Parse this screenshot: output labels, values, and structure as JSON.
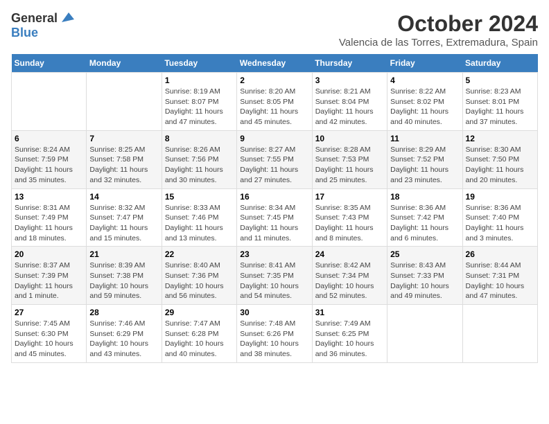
{
  "logo": {
    "general": "General",
    "blue": "Blue"
  },
  "title": {
    "month": "October 2024",
    "location": "Valencia de las Torres, Extremadura, Spain"
  },
  "headers": [
    "Sunday",
    "Monday",
    "Tuesday",
    "Wednesday",
    "Thursday",
    "Friday",
    "Saturday"
  ],
  "weeks": [
    [
      {
        "day": null
      },
      {
        "day": null
      },
      {
        "day": "1",
        "sunrise": "Sunrise: 8:19 AM",
        "sunset": "Sunset: 8:07 PM",
        "daylight": "Daylight: 11 hours and 47 minutes."
      },
      {
        "day": "2",
        "sunrise": "Sunrise: 8:20 AM",
        "sunset": "Sunset: 8:05 PM",
        "daylight": "Daylight: 11 hours and 45 minutes."
      },
      {
        "day": "3",
        "sunrise": "Sunrise: 8:21 AM",
        "sunset": "Sunset: 8:04 PM",
        "daylight": "Daylight: 11 hours and 42 minutes."
      },
      {
        "day": "4",
        "sunrise": "Sunrise: 8:22 AM",
        "sunset": "Sunset: 8:02 PM",
        "daylight": "Daylight: 11 hours and 40 minutes."
      },
      {
        "day": "5",
        "sunrise": "Sunrise: 8:23 AM",
        "sunset": "Sunset: 8:01 PM",
        "daylight": "Daylight: 11 hours and 37 minutes."
      }
    ],
    [
      {
        "day": "6",
        "sunrise": "Sunrise: 8:24 AM",
        "sunset": "Sunset: 7:59 PM",
        "daylight": "Daylight: 11 hours and 35 minutes."
      },
      {
        "day": "7",
        "sunrise": "Sunrise: 8:25 AM",
        "sunset": "Sunset: 7:58 PM",
        "daylight": "Daylight: 11 hours and 32 minutes."
      },
      {
        "day": "8",
        "sunrise": "Sunrise: 8:26 AM",
        "sunset": "Sunset: 7:56 PM",
        "daylight": "Daylight: 11 hours and 30 minutes."
      },
      {
        "day": "9",
        "sunrise": "Sunrise: 8:27 AM",
        "sunset": "Sunset: 7:55 PM",
        "daylight": "Daylight: 11 hours and 27 minutes."
      },
      {
        "day": "10",
        "sunrise": "Sunrise: 8:28 AM",
        "sunset": "Sunset: 7:53 PM",
        "daylight": "Daylight: 11 hours and 25 minutes."
      },
      {
        "day": "11",
        "sunrise": "Sunrise: 8:29 AM",
        "sunset": "Sunset: 7:52 PM",
        "daylight": "Daylight: 11 hours and 23 minutes."
      },
      {
        "day": "12",
        "sunrise": "Sunrise: 8:30 AM",
        "sunset": "Sunset: 7:50 PM",
        "daylight": "Daylight: 11 hours and 20 minutes."
      }
    ],
    [
      {
        "day": "13",
        "sunrise": "Sunrise: 8:31 AM",
        "sunset": "Sunset: 7:49 PM",
        "daylight": "Daylight: 11 hours and 18 minutes."
      },
      {
        "day": "14",
        "sunrise": "Sunrise: 8:32 AM",
        "sunset": "Sunset: 7:47 PM",
        "daylight": "Daylight: 11 hours and 15 minutes."
      },
      {
        "day": "15",
        "sunrise": "Sunrise: 8:33 AM",
        "sunset": "Sunset: 7:46 PM",
        "daylight": "Daylight: 11 hours and 13 minutes."
      },
      {
        "day": "16",
        "sunrise": "Sunrise: 8:34 AM",
        "sunset": "Sunset: 7:45 PM",
        "daylight": "Daylight: 11 hours and 11 minutes."
      },
      {
        "day": "17",
        "sunrise": "Sunrise: 8:35 AM",
        "sunset": "Sunset: 7:43 PM",
        "daylight": "Daylight: 11 hours and 8 minutes."
      },
      {
        "day": "18",
        "sunrise": "Sunrise: 8:36 AM",
        "sunset": "Sunset: 7:42 PM",
        "daylight": "Daylight: 11 hours and 6 minutes."
      },
      {
        "day": "19",
        "sunrise": "Sunrise: 8:36 AM",
        "sunset": "Sunset: 7:40 PM",
        "daylight": "Daylight: 11 hours and 3 minutes."
      }
    ],
    [
      {
        "day": "20",
        "sunrise": "Sunrise: 8:37 AM",
        "sunset": "Sunset: 7:39 PM",
        "daylight": "Daylight: 11 hours and 1 minute."
      },
      {
        "day": "21",
        "sunrise": "Sunrise: 8:39 AM",
        "sunset": "Sunset: 7:38 PM",
        "daylight": "Daylight: 10 hours and 59 minutes."
      },
      {
        "day": "22",
        "sunrise": "Sunrise: 8:40 AM",
        "sunset": "Sunset: 7:36 PM",
        "daylight": "Daylight: 10 hours and 56 minutes."
      },
      {
        "day": "23",
        "sunrise": "Sunrise: 8:41 AM",
        "sunset": "Sunset: 7:35 PM",
        "daylight": "Daylight: 10 hours and 54 minutes."
      },
      {
        "day": "24",
        "sunrise": "Sunrise: 8:42 AM",
        "sunset": "Sunset: 7:34 PM",
        "daylight": "Daylight: 10 hours and 52 minutes."
      },
      {
        "day": "25",
        "sunrise": "Sunrise: 8:43 AM",
        "sunset": "Sunset: 7:33 PM",
        "daylight": "Daylight: 10 hours and 49 minutes."
      },
      {
        "day": "26",
        "sunrise": "Sunrise: 8:44 AM",
        "sunset": "Sunset: 7:31 PM",
        "daylight": "Daylight: 10 hours and 47 minutes."
      }
    ],
    [
      {
        "day": "27",
        "sunrise": "Sunrise: 7:45 AM",
        "sunset": "Sunset: 6:30 PM",
        "daylight": "Daylight: 10 hours and 45 minutes."
      },
      {
        "day": "28",
        "sunrise": "Sunrise: 7:46 AM",
        "sunset": "Sunset: 6:29 PM",
        "daylight": "Daylight: 10 hours and 43 minutes."
      },
      {
        "day": "29",
        "sunrise": "Sunrise: 7:47 AM",
        "sunset": "Sunset: 6:28 PM",
        "daylight": "Daylight: 10 hours and 40 minutes."
      },
      {
        "day": "30",
        "sunrise": "Sunrise: 7:48 AM",
        "sunset": "Sunset: 6:26 PM",
        "daylight": "Daylight: 10 hours and 38 minutes."
      },
      {
        "day": "31",
        "sunrise": "Sunrise: 7:49 AM",
        "sunset": "Sunset: 6:25 PM",
        "daylight": "Daylight: 10 hours and 36 minutes."
      },
      {
        "day": null
      },
      {
        "day": null
      }
    ]
  ]
}
